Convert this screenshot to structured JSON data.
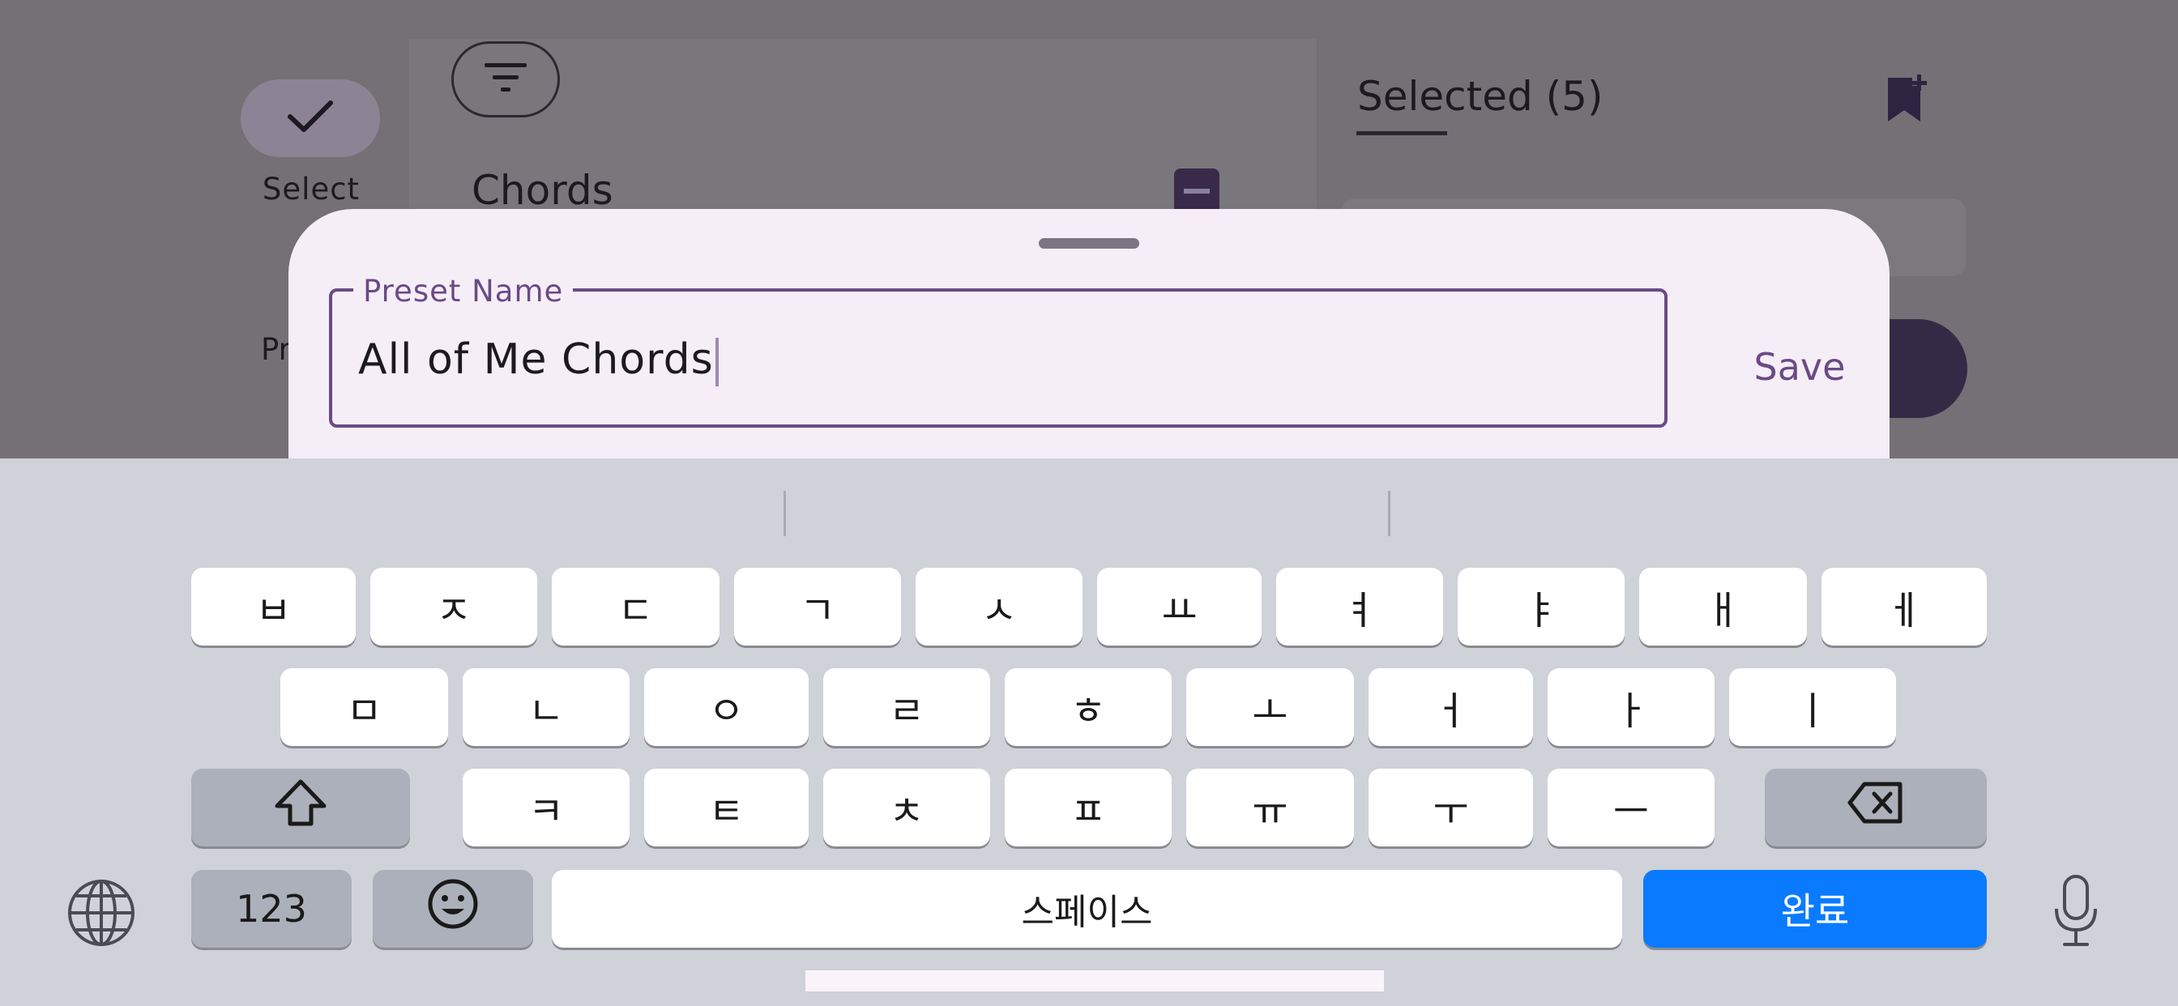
{
  "background_app": {
    "select_label": "Select",
    "partial_label": "Pr",
    "section_title": "Chords",
    "selected_title": "Selected (5)"
  },
  "sheet": {
    "field_label": "Preset Name",
    "field_value": "All of Me Chords",
    "save_label": "Save"
  },
  "keyboard": {
    "row1": [
      "ㅂ",
      "ㅈ",
      "ㄷ",
      "ㄱ",
      "ㅅ",
      "ㅛ",
      "ㅕ",
      "ㅑ",
      "ㅐ",
      "ㅔ"
    ],
    "row2": [
      "ㅁ",
      "ㄴ",
      "ㅇ",
      "ㄹ",
      "ㅎ",
      "ㅗ",
      "ㅓ",
      "ㅏ",
      "ㅣ"
    ],
    "row3": [
      "ㅋ",
      "ㅌ",
      "ㅊ",
      "ㅍ",
      "ㅠ",
      "ㅜ",
      "ㅡ"
    ],
    "numbers_key": "123",
    "space_key": "스페이스",
    "done_key": "완료"
  },
  "colors": {
    "accent_purple": "#6a4a86",
    "keyboard_blue": "#0a7bff",
    "sheet_background": "#f6eef7"
  },
  "icons": [
    "checkmark-icon",
    "filter-icon",
    "bookmark-add-icon",
    "shift-icon",
    "backspace-icon",
    "emoji-icon",
    "globe-icon",
    "microphone-icon"
  ]
}
